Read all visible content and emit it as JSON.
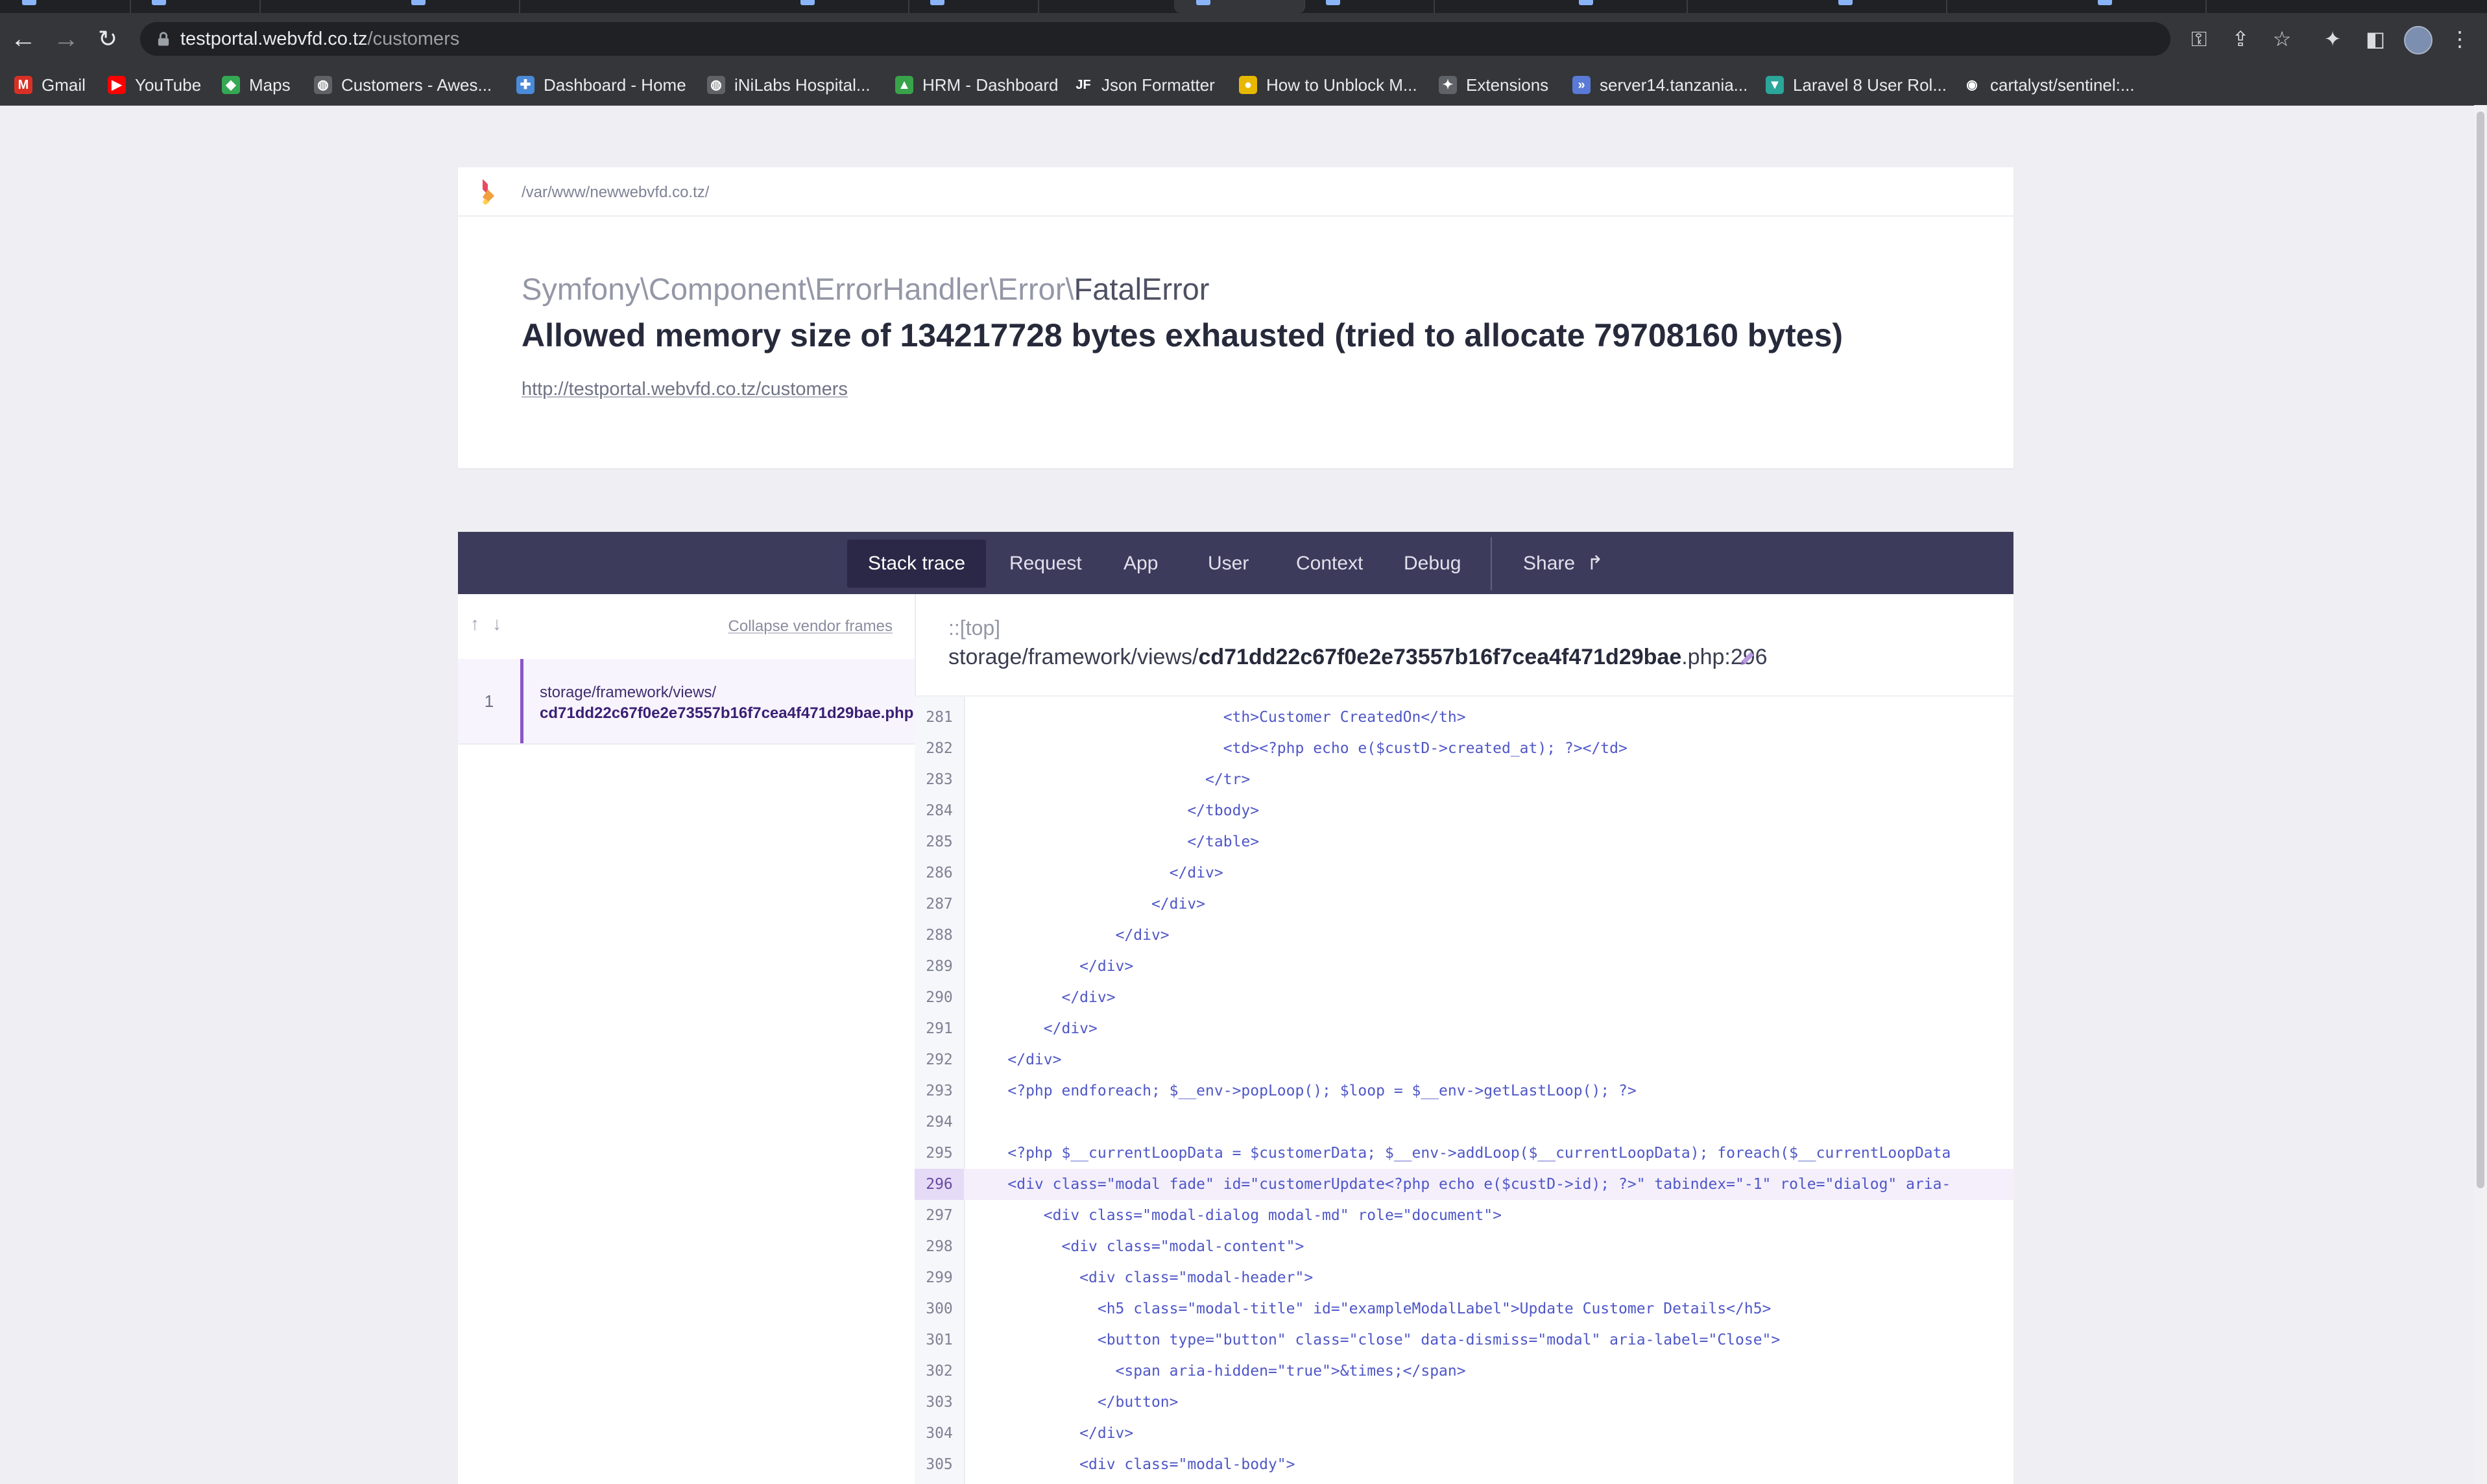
{
  "browser": {
    "url_host": "testportal.webvfd.co.tz",
    "url_path": "/customers",
    "bookmarks": [
      {
        "label": "Gmail",
        "icon": "gmail-icon",
        "color": "#d93025",
        "glyph": "M"
      },
      {
        "label": "YouTube",
        "icon": "youtube-icon",
        "color": "#ff0000",
        "glyph": "▶"
      },
      {
        "label": "Maps",
        "icon": "maps-icon",
        "color": "#34a853",
        "glyph": "◆"
      },
      {
        "label": "Customers - Awes...",
        "icon": "globe-icon",
        "color": "#5f6368",
        "glyph": "◍"
      },
      {
        "label": "Dashboard - Home",
        "icon": "dashboard-icon",
        "color": "#4a8ad8",
        "glyph": "✚"
      },
      {
        "label": "iNiLabs Hospital...",
        "icon": "globe-icon",
        "color": "#5f6368",
        "glyph": "◍"
      },
      {
        "label": "HRM - Dashboard",
        "icon": "hrm-icon",
        "color": "#38a34a",
        "glyph": "▲"
      },
      {
        "label": "Json Formatter",
        "icon": "json-formatter-icon",
        "color": "#35363a",
        "glyph": "JF"
      },
      {
        "label": "How to Unblock M...",
        "icon": "unblock-icon",
        "color": "#e6b800",
        "glyph": "●"
      },
      {
        "label": "Extensions",
        "icon": "extensions-icon",
        "color": "#5f6368",
        "glyph": "✦"
      },
      {
        "label": "server14.tanzania...",
        "icon": "server-icon",
        "color": "#5a7ad8",
        "glyph": "»"
      },
      {
        "label": "Laravel 8 User Rol...",
        "icon": "laravel-icon",
        "color": "#2aa69a",
        "glyph": "▼"
      },
      {
        "label": "cartalyst/sentinel:...",
        "icon": "github-icon",
        "color": "#35363a",
        "glyph": "◉"
      }
    ]
  },
  "error": {
    "app_path": "/var/www/newwebvfd.co.tz/",
    "class_prefix": "Symfony\\Component\\ErrorHandler\\Error\\",
    "class_name": "FatalError",
    "message": "Allowed memory size of 134217728 bytes exhausted (tried to allocate 79708160 bytes)",
    "url": "http://testportal.webvfd.co.tz/customers"
  },
  "tabs": [
    {
      "label": "Stack trace",
      "active": true
    },
    {
      "label": "Request"
    },
    {
      "label": "App"
    },
    {
      "label": "User"
    },
    {
      "label": "Context"
    },
    {
      "label": "Debug"
    },
    {
      "label": "Share"
    }
  ],
  "frames": {
    "collapse_label": "Collapse vendor frames",
    "items": [
      {
        "number": "1",
        "dir": "storage/framework/views/",
        "file": "cd71dd22c67f0e2e73557b16f7cea4f471d29bae.php"
      }
    ]
  },
  "selected_frame": {
    "class": "::[top]",
    "path_dir": "storage/framework/views/",
    "path_file": "cd71dd22c67f0e2e73557b16f7cea4f471d29bae",
    "path_ext": ".php:296",
    "highlighted_line": "296",
    "lines": [
      {
        "n": "281",
        "code": "                            <th>Customer CreatedOn</th>"
      },
      {
        "n": "282",
        "code": "                            <td><?php echo e($custD->created_at); ?></td>"
      },
      {
        "n": "283",
        "code": "                          </tr>"
      },
      {
        "n": "284",
        "code": "                        </tbody>"
      },
      {
        "n": "285",
        "code": "                        </table>"
      },
      {
        "n": "286",
        "code": "                      </div>"
      },
      {
        "n": "287",
        "code": "                    </div>"
      },
      {
        "n": "288",
        "code": "                </div>"
      },
      {
        "n": "289",
        "code": "            </div>"
      },
      {
        "n": "290",
        "code": "          </div>"
      },
      {
        "n": "291",
        "code": "        </div>"
      },
      {
        "n": "292",
        "code": "    </div>"
      },
      {
        "n": "293",
        "code": "    <?php endforeach; $__env->popLoop(); $loop = $__env->getLastLoop(); ?>"
      },
      {
        "n": "294",
        "code": ""
      },
      {
        "n": "295",
        "code": "    <?php $__currentLoopData = $customerData; $__env->addLoop($__currentLoopData); foreach($__currentLoopData"
      },
      {
        "n": "296",
        "code": "    <div class=\"modal fade\" id=\"customerUpdate<?php echo e($custD->id); ?>\" tabindex=\"-1\" role=\"dialog\" aria-"
      },
      {
        "n": "297",
        "code": "        <div class=\"modal-dialog modal-md\" role=\"document\">"
      },
      {
        "n": "298",
        "code": "          <div class=\"modal-content\">"
      },
      {
        "n": "299",
        "code": "            <div class=\"modal-header\">"
      },
      {
        "n": "300",
        "code": "              <h5 class=\"modal-title\" id=\"exampleModalLabel\">Update Customer Details</h5>"
      },
      {
        "n": "301",
        "code": "              <button type=\"button\" class=\"close\" data-dismiss=\"modal\" aria-label=\"Close\">"
      },
      {
        "n": "302",
        "code": "                <span aria-hidden=\"true\">&times;</span>"
      },
      {
        "n": "303",
        "code": "              </button>"
      },
      {
        "n": "304",
        "code": "            </div>"
      },
      {
        "n": "305",
        "code": "            <div class=\"modal-body\">"
      }
    ]
  }
}
